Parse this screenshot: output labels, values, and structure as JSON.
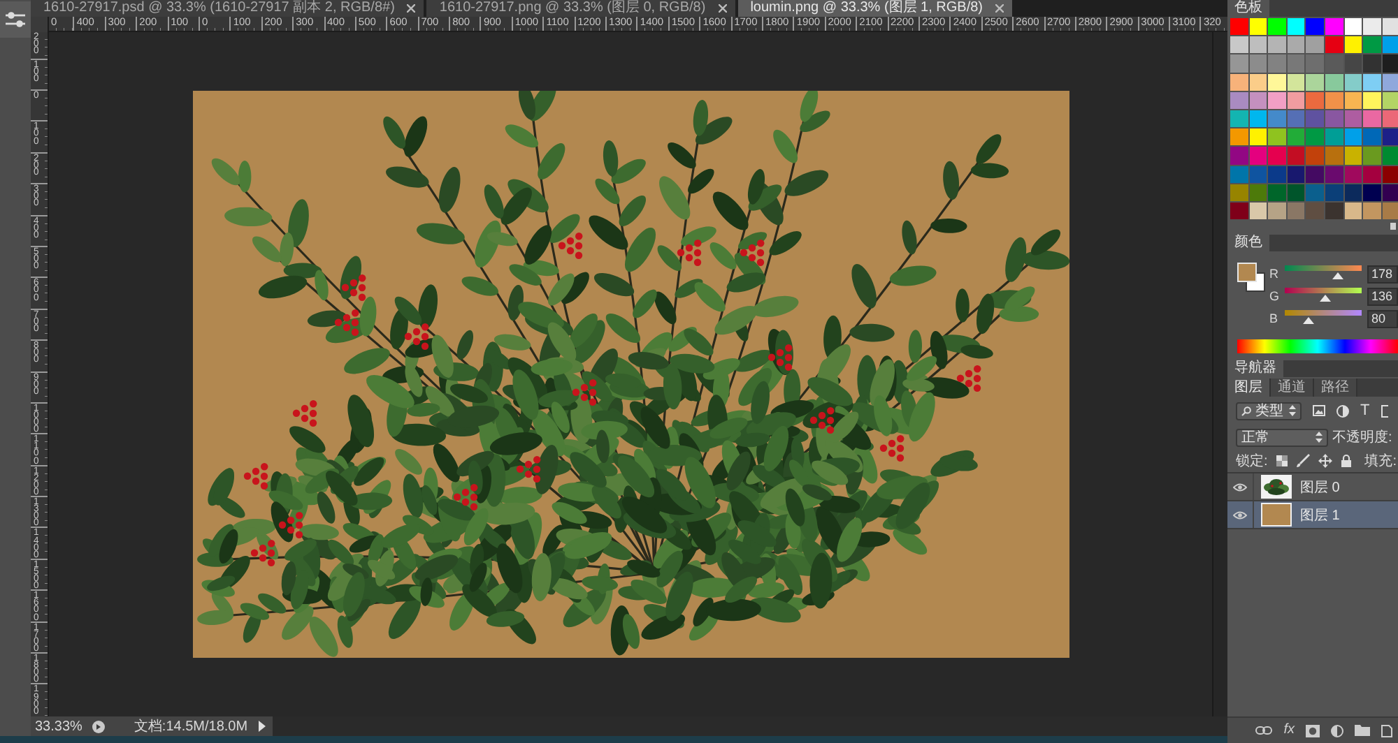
{
  "document_tabs": [
    {
      "title": "1610-27917.psd @ 33.3% (1610-27917 副本 2, RGB/8#)",
      "selected": false
    },
    {
      "title": "1610-27917.png @ 33.3% (图层 0, RGB/8)",
      "selected": false
    },
    {
      "title": "loumin.png @ 33.3% (图层 1, RGB/8)",
      "selected": true
    }
  ],
  "rulers": {
    "horizontal": [
      "0",
      "400",
      "300",
      "200",
      "100",
      "0",
      "100",
      "200",
      "300",
      "400",
      "500",
      "600",
      "700",
      "800",
      "900",
      "1000",
      "1100",
      "1200",
      "1300",
      "1400",
      "1500",
      "1600",
      "1700",
      "1800",
      "1900",
      "2000",
      "2100",
      "2200",
      "2300",
      "2400",
      "2500",
      "2600",
      "2700",
      "2800",
      "2900",
      "3000",
      "3100",
      "320"
    ],
    "vertical": [
      "200",
      "100",
      "0",
      "100",
      "200",
      "300",
      "400",
      "500",
      "600",
      "700",
      "800",
      "900",
      "1000",
      "1100",
      "1200",
      "1300",
      "1400",
      "1500",
      "1600",
      "1700",
      "1800",
      "1900"
    ]
  },
  "status_bar": {
    "zoom": "33.33%",
    "document_size": "文档:14.5M/18.0M"
  },
  "swatches_panel": {
    "title": "色板",
    "swatches": [
      {
        "color": "#ff0000"
      },
      {
        "color": "#ffff00"
      },
      {
        "color": "#00ff00"
      },
      {
        "color": "#00ffff"
      },
      {
        "color": "#0000ff"
      },
      {
        "color": "#ff00ff"
      },
      {
        "color": "#ffffff"
      },
      {
        "color": "#ebebeb"
      },
      {
        "color": "#e1e1e1"
      },
      {
        "color": "#c8c8c8"
      },
      {
        "color": "#bebebe"
      },
      {
        "color": "#b4b4b4"
      },
      {
        "color": "#aaaaaa"
      },
      {
        "color": "#a0a0a0"
      },
      {
        "color": "#e60012"
      },
      {
        "color": "#fff100"
      },
      {
        "color": "#009944"
      },
      {
        "color": "#00a0e9"
      },
      {
        "color": "#969696"
      },
      {
        "color": "#8c8c8c"
      },
      {
        "color": "#828282"
      },
      {
        "color": "#787878"
      },
      {
        "color": "#6e6e6e"
      },
      {
        "color": "#5a5a5a"
      },
      {
        "color": "#464646"
      },
      {
        "color": "#323232"
      },
      {
        "color": "#1e1e1e"
      },
      {
        "color": "#f7b27a"
      },
      {
        "color": "#fbcd89"
      },
      {
        "color": "#fff799"
      },
      {
        "color": "#d3e59b"
      },
      {
        "color": "#abd59b"
      },
      {
        "color": "#88c99c"
      },
      {
        "color": "#84ccc9"
      },
      {
        "color": "#7ecef4"
      },
      {
        "color": "#8fa8dc"
      },
      {
        "color": "#a98bc1"
      },
      {
        "color": "#c490bf"
      },
      {
        "color": "#f29fc5"
      },
      {
        "color": "#f19ca0"
      },
      {
        "color": "#eb6a3f"
      },
      {
        "color": "#f19149"
      },
      {
        "color": "#f8b551"
      },
      {
        "color": "#fff45c"
      },
      {
        "color": "#b3d465"
      },
      {
        "color": "#13b5b1"
      },
      {
        "color": "#00b7ee"
      },
      {
        "color": "#448aca"
      },
      {
        "color": "#556fb5"
      },
      {
        "color": "#5f52a0"
      },
      {
        "color": "#8957a1"
      },
      {
        "color": "#ae5da1"
      },
      {
        "color": "#ea68a2"
      },
      {
        "color": "#eb6877"
      },
      {
        "color": "#f39800"
      },
      {
        "color": "#fff100"
      },
      {
        "color": "#8fc31f"
      },
      {
        "color": "#22ac38"
      },
      {
        "color": "#009944"
      },
      {
        "color": "#009e96"
      },
      {
        "color": "#00a0e9"
      },
      {
        "color": "#0068b7"
      },
      {
        "color": "#1d2088"
      },
      {
        "color": "#920783"
      },
      {
        "color": "#e4007f"
      },
      {
        "color": "#e5004f"
      },
      {
        "color": "#c30d23"
      },
      {
        "color": "#c2410b"
      },
      {
        "color": "#b8700e"
      },
      {
        "color": "#c9b200"
      },
      {
        "color": "#6a9a1f"
      },
      {
        "color": "#008a30"
      },
      {
        "color": "#0075a9"
      },
      {
        "color": "#0f54a0"
      },
      {
        "color": "#0b3a8a"
      },
      {
        "color": "#18186e"
      },
      {
        "color": "#440a62"
      },
      {
        "color": "#6a0a6e"
      },
      {
        "color": "#a0095d"
      },
      {
        "color": "#a4003f"
      },
      {
        "color": "#8b0000"
      },
      {
        "color": "#978400"
      },
      {
        "color": "#4d7a0a"
      },
      {
        "color": "#00662a"
      },
      {
        "color": "#00552b"
      },
      {
        "color": "#0b5f8d"
      },
      {
        "color": "#0b3f78"
      },
      {
        "color": "#0c2a5c"
      },
      {
        "color": "#000050"
      },
      {
        "color": "#320050"
      },
      {
        "color": "#7f0019"
      },
      {
        "color": "#d9c8a9"
      },
      {
        "color": "#b6a386"
      },
      {
        "color": "#8a7765"
      },
      {
        "color": "#5f4e42"
      },
      {
        "color": "#3b332f"
      },
      {
        "color": "#d8b88a"
      },
      {
        "color": "#c39660"
      },
      {
        "color": "#a87b47"
      }
    ]
  },
  "color_panel": {
    "title": "颜色",
    "foreground": {
      "color": "#b28850"
    },
    "background": {
      "color": "#ffffff"
    },
    "channels": [
      {
        "name": "R",
        "level": 0.698,
        "value": "178"
      },
      {
        "name": "G",
        "level": 0.533,
        "value": "136"
      },
      {
        "name": "B",
        "level": 0.314,
        "value": "80"
      }
    ]
  },
  "navigator_panel": {
    "title": "导航器"
  },
  "layers_panel": {
    "tabs": [
      {
        "label": "图层",
        "selected": true
      },
      {
        "label": "通道",
        "selected": false
      },
      {
        "label": "路径",
        "selected": false
      }
    ],
    "filter": {
      "value": "类型",
      "text_filter_label": "T"
    },
    "blend_mode": {
      "value": "正常"
    },
    "opacity_label": "不透明度:",
    "lock_label": "锁定:",
    "fill_label": "填充:",
    "layers": [
      {
        "name": "图层 0",
        "kind": "image",
        "visible": true,
        "selected": false
      },
      {
        "name": "图层 1",
        "kind": "fill",
        "visible": true,
        "selected": true
      }
    ],
    "effects_label": "fx"
  }
}
